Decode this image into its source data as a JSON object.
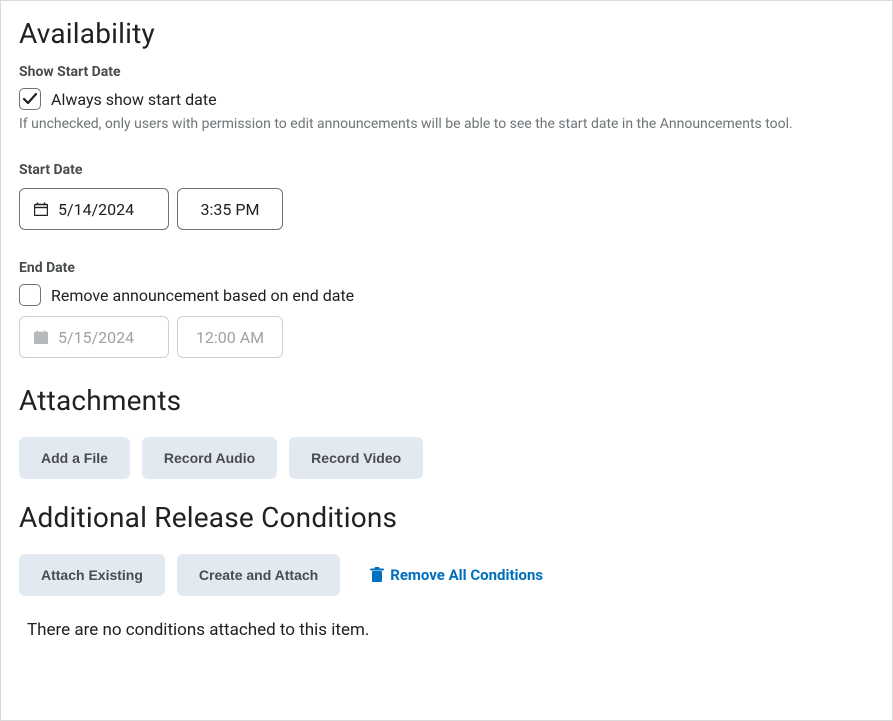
{
  "availability": {
    "heading": "Availability",
    "show_start_label": "Show Start Date",
    "always_show_label": "Always show start date",
    "always_show_checked": true,
    "hint": "If unchecked, only users with permission to edit announcements will be able to see the start date in the Announcements tool.",
    "start_date_label": "Start Date",
    "start_date": "5/14/2024",
    "start_time": "3:35 PM",
    "end_date_label": "End Date",
    "remove_label": "Remove announcement based on end date",
    "remove_checked": false,
    "end_date": "5/15/2024",
    "end_time": "12:00 AM"
  },
  "attachments": {
    "heading": "Attachments",
    "add_file": "Add a File",
    "record_audio": "Record Audio",
    "record_video": "Record Video"
  },
  "conditions": {
    "heading": "Additional Release Conditions",
    "attach_existing": "Attach Existing",
    "create_attach": "Create and Attach",
    "remove_all": "Remove All Conditions",
    "empty": "There are no conditions attached to this item."
  }
}
